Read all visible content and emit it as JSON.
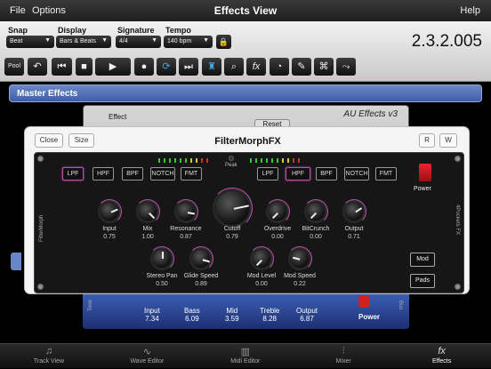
{
  "menubar": {
    "file": "File",
    "options": "Options",
    "title": "Effects View",
    "help": "Help"
  },
  "toolbar": {
    "snap_label": "Snap",
    "snap_value": "Beat",
    "display_label": "Display",
    "display_value": "Bars & Beats",
    "signature_label": "Signature",
    "signature_value": "4/4",
    "tempo_label": "Tempo",
    "tempo_value": "140 bpm",
    "lock_icon": "lock-icon",
    "timecode": "2.3.2.005",
    "pool": "Pool",
    "fx": "fx",
    "buttons": [
      "undo-icon",
      "rewind-icon",
      "stop-icon",
      "play-icon",
      "record-icon",
      "loop-icon",
      "forward-icon",
      "metronome-icon",
      "zoom-icon",
      "fx-button",
      "duck-icon",
      "wrench-icon",
      "binoculars-icon",
      "route-icon"
    ]
  },
  "master": {
    "label": "Master Effects"
  },
  "au": {
    "effect_label": "Effect",
    "title": "AU Effects v3",
    "reset": "Reset",
    "knobs": [
      {
        "label": "Input",
        "value": "7.34"
      },
      {
        "label": "Bass",
        "value": "6.09"
      },
      {
        "label": "Mid",
        "value": "3.59"
      },
      {
        "label": "Treble",
        "value": "8.28"
      },
      {
        "label": "Output",
        "value": "6.87"
      }
    ],
    "power": "Power",
    "side_left": "Tone",
    "side_right": "Bus"
  },
  "dialog": {
    "close": "Close",
    "size": "Size",
    "title": "FilterMorphFX",
    "r": "R",
    "w": "W"
  },
  "plugin": {
    "peak": "Peak",
    "left_filters": [
      {
        "label": "LPF",
        "on": true
      },
      {
        "label": "HPF",
        "on": false
      },
      {
        "label": "BPF",
        "on": false
      },
      {
        "label": "NOTCH",
        "on": false
      },
      {
        "label": "FMT",
        "on": false
      }
    ],
    "right_filters": [
      {
        "label": "LPF",
        "on": false
      },
      {
        "label": "HPF",
        "on": true
      },
      {
        "label": "BPF",
        "on": false
      },
      {
        "label": "NOTCH",
        "on": false
      },
      {
        "label": "FMT",
        "on": false
      }
    ],
    "power": "Power",
    "side_left": "FilterMorph",
    "side_right": "4Pockets FX",
    "knobs": {
      "input": {
        "label": "Input",
        "value": "0.75"
      },
      "mix": {
        "label": "Mix",
        "value": "1.00"
      },
      "resonance": {
        "label": "Resonance",
        "value": "0.87"
      },
      "cutoff": {
        "label": "Cutoff",
        "value": "0.79"
      },
      "overdrive": {
        "label": "Overdrive",
        "value": "0.00"
      },
      "bitcrunch": {
        "label": "BitCrunch",
        "value": "0.00"
      },
      "output": {
        "label": "Output",
        "value": "0.71"
      },
      "stereo_pan": {
        "label": "Stereo Pan",
        "value": "0.50"
      },
      "glide_speed": {
        "label": "Glide Speed",
        "value": "0.89"
      },
      "mod_level": {
        "label": "Mod Level",
        "value": "0.00"
      },
      "mod_speed": {
        "label": "Mod Speed",
        "value": "0.22"
      }
    },
    "mod": "Mod",
    "pads": "Pads"
  },
  "tabs": [
    {
      "label": "Track View",
      "icon": "music-note-icon",
      "active": false
    },
    {
      "label": "Wave Editor",
      "icon": "waveform-icon",
      "active": false
    },
    {
      "label": "Midi Editor",
      "icon": "piano-keys-icon",
      "active": false
    },
    {
      "label": "Mixer",
      "icon": "mixer-faders-icon",
      "active": false
    },
    {
      "label": "Effects",
      "icon": "fx-icon",
      "active": true
    }
  ]
}
